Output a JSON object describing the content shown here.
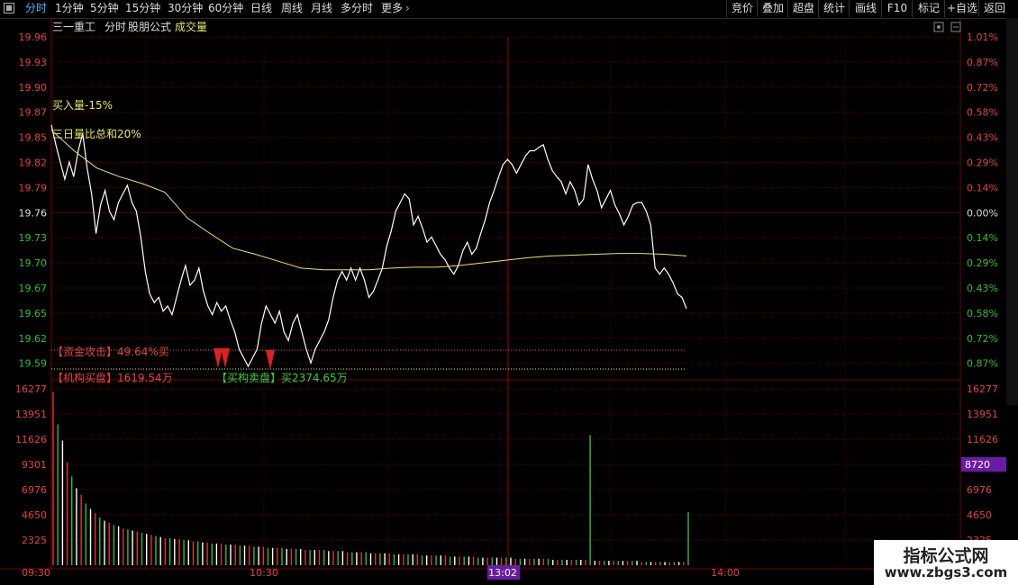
{
  "toolbar": {
    "tabs": [
      "分时",
      "1分钟",
      "5分钟",
      "15分钟",
      "30分钟",
      "60分钟",
      "日线",
      "周线",
      "月线",
      "多分时",
      "更多"
    ],
    "active_tab": "分时",
    "more_chevron": "›",
    "right_buttons": [
      "竞价",
      "叠加",
      "超盘",
      "统计",
      "画线",
      "F10",
      "标记",
      "+自选",
      "返回"
    ]
  },
  "header": {
    "stock_name": "三一重工",
    "mode": "分时",
    "formula": "股朋公式",
    "sub_label": "成交量"
  },
  "annotations": {
    "buy_volume": "买入量-15%",
    "three_day": "三日量比总和20%",
    "capital_attack": "【资金攻击】49.64%买",
    "institution": "【机构买盘】1619.54万",
    "inst_sell": "【买构卖盘】买2374.65万"
  },
  "price_axis": {
    "left": [
      "19.96",
      "19.93",
      "19.90",
      "19.87",
      "19.85",
      "19.82",
      "19.79",
      "19.76",
      "19.73",
      "19.70",
      "19.67",
      "19.65",
      "19.62",
      "19.59"
    ],
    "right": [
      "1.01%",
      "0.87%",
      "0.72%",
      "0.58%",
      "0.43%",
      "0.29%",
      "0.14%",
      "0.00%",
      "0.14%",
      "0.29%",
      "0.43%",
      "0.58%",
      "0.72%",
      "0.87%"
    ]
  },
  "volume_axis": {
    "left": [
      "16277",
      "13951",
      "11626",
      "9301",
      "6976",
      "4650",
      "2325"
    ],
    "right": [
      "16277",
      "13951",
      "11626",
      "8720",
      "6976",
      "4650",
      "2325"
    ],
    "highlight": "8720"
  },
  "time_axis": [
    "09:30",
    "10:30",
    "13:02",
    "14:00"
  ],
  "time_highlight": "13:02",
  "watermark": {
    "line1": "指标公式网",
    "line2": "www.zbgs3.com"
  },
  "colors": {
    "price_line": "#ffffff",
    "avg_line": "#e8e85a",
    "grid": "#5a0000",
    "up": "#e83030",
    "down": "#30c030",
    "accent": "#6a1aa8"
  },
  "chart_data": {
    "type": "line",
    "series": [
      {
        "values": [
          19.868,
          19.845,
          19.825,
          19.805,
          19.825,
          19.808,
          19.838,
          19.858,
          19.818,
          19.788,
          19.742,
          19.775,
          19.792,
          19.768,
          19.758,
          19.778,
          19.788,
          19.798,
          19.778,
          19.768,
          19.738,
          19.698,
          19.672,
          19.662,
          19.668,
          19.652,
          19.658,
          19.648,
          19.668,
          19.688,
          19.705,
          19.682,
          19.688,
          19.702,
          19.675,
          19.658,
          19.648,
          19.662,
          19.652,
          19.658,
          19.642,
          19.628,
          19.608,
          19.598,
          19.588,
          19.598,
          19.608,
          19.638,
          19.658,
          19.648,
          19.638,
          19.652,
          19.628,
          19.618,
          19.638,
          19.648,
          19.628,
          19.608,
          19.592,
          19.608,
          19.618,
          19.628,
          19.642,
          19.668,
          19.688,
          19.698,
          19.688,
          19.702,
          19.688,
          19.702,
          19.688,
          19.668,
          19.675,
          19.688,
          19.702,
          19.728,
          19.745,
          19.768,
          19.778,
          19.788,
          19.782,
          19.752,
          19.762,
          19.748,
          19.732,
          19.738,
          19.728,
          19.718,
          19.712,
          19.702,
          19.695,
          19.705,
          19.722,
          19.732,
          19.718,
          19.725,
          19.742,
          19.758,
          19.778,
          19.792,
          19.808,
          19.822,
          19.828,
          19.822,
          19.812,
          19.822,
          19.832,
          19.838,
          19.838,
          19.842,
          19.845,
          19.828,
          19.815,
          19.808,
          19.802,
          19.788,
          19.802,
          19.792,
          19.775,
          19.782,
          19.822,
          19.805,
          19.792,
          19.772,
          19.782,
          19.792,
          19.775,
          19.765,
          19.752,
          19.762,
          19.775,
          19.778,
          19.778,
          19.768,
          19.752,
          19.702,
          19.695,
          19.702,
          19.695,
          19.685,
          19.672,
          19.668,
          19.655
        ]
      },
      {
        "values": [
          19.862,
          19.838,
          19.818,
          19.808,
          19.8,
          19.79,
          19.76,
          19.742,
          19.725,
          19.718,
          19.71,
          19.702,
          19.7,
          19.7,
          19.7,
          19.702,
          19.703,
          19.703,
          19.705,
          19.708,
          19.711,
          19.714,
          19.716,
          19.717,
          19.718,
          19.719,
          19.719,
          19.718,
          19.716
        ]
      }
    ],
    "volume": [
      16000,
      13000,
      11500,
      9500,
      8200,
      7100,
      6500,
      5700,
      5200,
      4800,
      4400,
      4100,
      3900,
      3700,
      3600,
      3400,
      3300,
      3200,
      3100,
      3000,
      2900,
      2800,
      2700,
      2600,
      2500,
      2500,
      2400,
      2400,
      2300,
      2300,
      2200,
      2200,
      2100,
      2100,
      2000,
      2000,
      2000,
      1900,
      1900,
      1900,
      1800,
      1800,
      1800,
      1700,
      1700,
      1700,
      1600,
      1600,
      1600,
      1600,
      1500,
      1500,
      1500,
      1500,
      1400,
      1400,
      1400,
      1400,
      1400,
      1300,
      1300,
      1300,
      1300,
      1200,
      1200,
      1200,
      1200,
      1200,
      1100,
      1100,
      1100,
      1100,
      1100,
      1000,
      1000,
      1000,
      1000,
      1000,
      1000,
      900,
      900,
      900,
      900,
      900,
      900,
      800,
      800,
      800,
      800,
      800,
      800,
      700,
      700,
      700,
      700,
      700,
      700,
      700,
      700,
      600,
      600,
      600,
      600,
      600,
      600,
      600,
      600,
      500,
      500,
      500,
      500,
      500,
      500,
      500,
      500,
      12000,
      400,
      400,
      400,
      400,
      400,
      400,
      400,
      400,
      400,
      400,
      300,
      300,
      300,
      300,
      300,
      300,
      300,
      300,
      300,
      300,
      4900
    ],
    "ylim": [
      19.585,
      19.97
    ],
    "vol_max": 16277
  }
}
